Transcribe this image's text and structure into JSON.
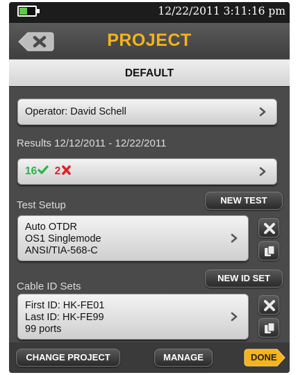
{
  "status": {
    "datetime": "12/22/2011 3:11:16 pm",
    "battery_level": 0.45
  },
  "header": {
    "title": "PROJECT",
    "back_icon": "close-icon"
  },
  "project": {
    "name": "DEFAULT"
  },
  "operator": {
    "label": "Operator: David Schell"
  },
  "results": {
    "range_label": "Results 12/12/2011 - 12/22/2011",
    "pass_count": "16",
    "fail_count": "2",
    "pass_color": "#2db34a",
    "fail_color": "#e0232b"
  },
  "test_setup": {
    "label": "Test Setup",
    "new_button": "NEW TEST",
    "lines": [
      "Auto OTDR",
      "OS1 Singlemode",
      "ANSI/TIA-568-C"
    ]
  },
  "cable_id_sets": {
    "label": "Cable ID Sets",
    "new_button": "NEW ID SET",
    "lines": [
      "First ID: HK-FE01",
      "Last ID: HK-FE99",
      "99 ports"
    ]
  },
  "footer": {
    "change_project": "CHANGE PROJECT",
    "manage": "MANAGE",
    "done": "DONE"
  },
  "colors": {
    "accent": "#f5b31c",
    "panel": "#4a4a4a"
  }
}
